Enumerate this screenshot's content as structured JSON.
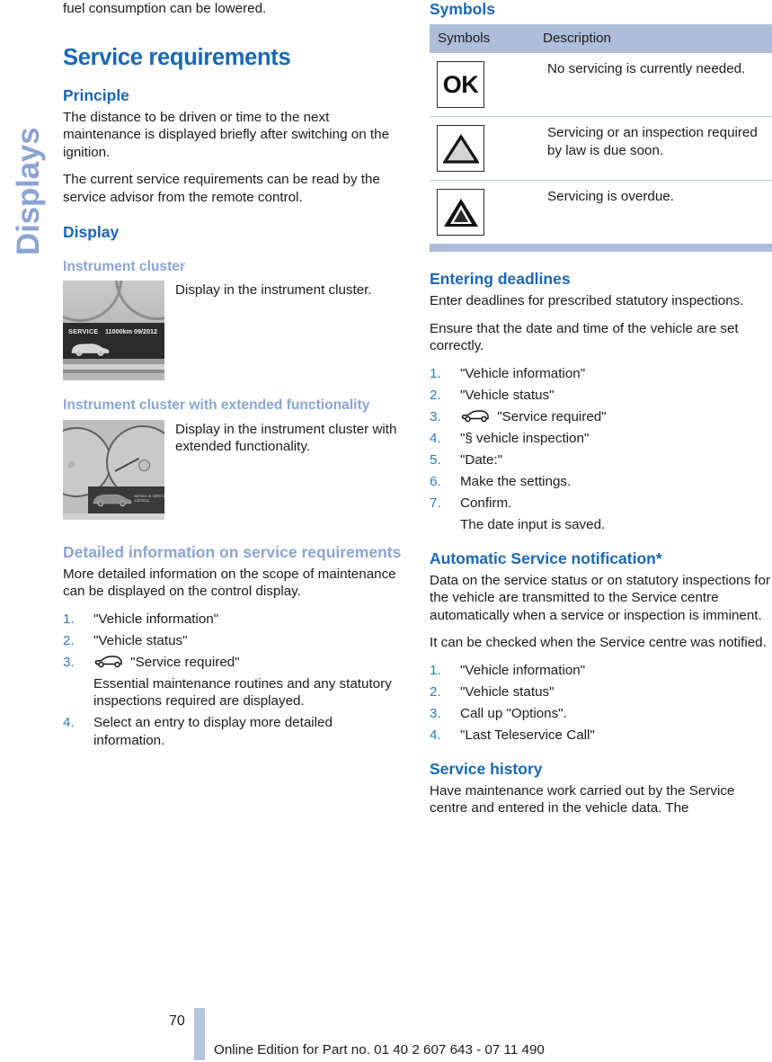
{
  "chapter_tab": {
    "label": "Displays",
    "color": "#8ba4d4"
  },
  "left_column": {
    "continued_paragraph": "fuel consumption can be lowered.",
    "chapter_heading": "Service requirements",
    "principle": {
      "heading": "Principle",
      "paragraph_1": "The distance to be driven or time to the next maintenance is displayed briefly after switching on the ignition.",
      "paragraph_2": "The current service requirements can be read by the service advisor from the remote control."
    },
    "display": {
      "heading": "Display",
      "instrument_cluster": {
        "heading": "Instrument cluster",
        "caption": "Display in the instrument cluster.",
        "image": {
          "label": "SERVICE",
          "value": "11000km 09/2012"
        }
      },
      "instrument_cluster_extended": {
        "heading": "Instrument cluster with extended functionality",
        "caption": "Display in the instrument cluster with extended functionality.",
        "image": {
          "line_1": "Service in 1800 km",
          "line_2": "1/2/2012"
        }
      }
    },
    "detailed_information": {
      "heading": "Detailed information on service requirements",
      "paragraph": "More detailed information on the scope of maintenance can be displayed on the control display.",
      "steps": [
        {
          "text": "\"Vehicle information\"",
          "icon": null,
          "note": null
        },
        {
          "text": "\"Vehicle status\"",
          "icon": null,
          "note": null
        },
        {
          "text": "\"Service required\"",
          "icon": "car-icon",
          "note": "Essential maintenance routines and any statutory inspections required are displayed."
        },
        {
          "text": "Select an entry to display more detailed information.",
          "icon": null,
          "note": null
        }
      ]
    }
  },
  "right_column": {
    "symbols": {
      "heading": "Symbols",
      "columns": [
        "Symbols",
        "Description"
      ],
      "rows": [
        {
          "symbol": "ok-box-icon",
          "symbol_label": "OK",
          "description": "No servicing is currently needed."
        },
        {
          "symbol": "triangle-outline-icon",
          "symbol_label": "",
          "description": "Servicing or an inspection required by law is due soon."
        },
        {
          "symbol": "triangle-filled-icon",
          "symbol_label": "",
          "description": "Servicing is overdue."
        }
      ]
    },
    "entering_deadlines": {
      "heading": "Entering deadlines",
      "paragraph_1": "Enter deadlines for prescribed statutory inspections.",
      "paragraph_2": "Ensure that the date and time of the vehicle are set correctly.",
      "steps": [
        {
          "text": "\"Vehicle information\"",
          "icon": null,
          "note": null
        },
        {
          "text": "\"Vehicle status\"",
          "icon": null,
          "note": null
        },
        {
          "text": "\"Service required\"",
          "icon": "car-icon",
          "note": null
        },
        {
          "text": "\"§ vehicle inspection\"",
          "icon": null,
          "note": null
        },
        {
          "text": "\"Date:\"",
          "icon": null,
          "note": null
        },
        {
          "text": "Make the settings.",
          "icon": null,
          "note": null
        },
        {
          "text": "Confirm.",
          "icon": null,
          "note": "The date input is saved."
        }
      ]
    },
    "automatic_service_notification": {
      "heading": "Automatic Service notification*",
      "paragraph_1": "Data on the service status or on statutory inspections for the vehicle are transmitted to the Service centre automatically when a service or inspection is imminent.",
      "paragraph_2": "It can be checked when the Service centre was notified.",
      "steps": [
        {
          "text": "\"Vehicle information\"",
          "icon": null,
          "note": null
        },
        {
          "text": "\"Vehicle status\"",
          "icon": null,
          "note": null
        },
        {
          "text": "Call up \"Options\".",
          "icon": null,
          "note": null
        },
        {
          "text": "\"Last Teleservice Call\"",
          "icon": null,
          "note": null
        }
      ]
    },
    "service_history": {
      "heading": "Service history",
      "paragraph": "Have maintenance work carried out by the Service centre and entered in the vehicle data. The"
    }
  },
  "footer": {
    "page_number": "70",
    "note": "Online Edition for Part no. 01 40 2 607 643 - 07 11 490"
  },
  "colors": {
    "heading_blue": "#1a67b3",
    "subheading_periwinkle": "#8ba4d4",
    "table_header_bg": "#aebdda",
    "step_number_blue": "#2d7ac4"
  }
}
